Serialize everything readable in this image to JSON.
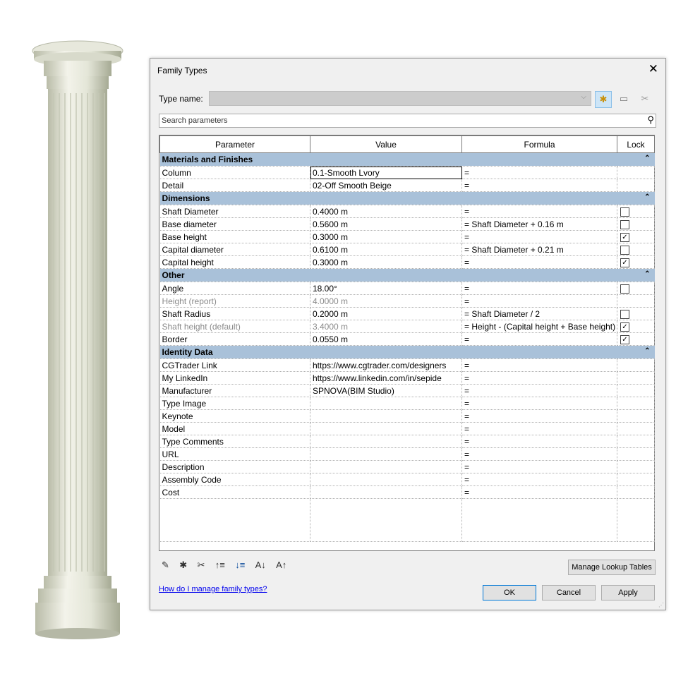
{
  "dialog": {
    "title": "Family Types",
    "type_name_label": "Type name:",
    "type_name_value": "",
    "search_placeholder": "Search parameters",
    "help_link": "How do I manage family types?",
    "buttons": {
      "manage_lookup": "Manage Lookup Tables",
      "ok": "OK",
      "cancel": "Cancel",
      "apply": "Apply"
    }
  },
  "table": {
    "headers": [
      "Parameter",
      "Value",
      "Formula",
      "Lock"
    ],
    "groups": [
      {
        "name": "Materials and Finishes",
        "rows": [
          {
            "param": "Column",
            "value": "0.1-Smooth Lvory",
            "formula": "=",
            "lock": null,
            "selected": true
          },
          {
            "param": "Detail",
            "value": "02-Off Smooth Beige",
            "formula": "=",
            "lock": null
          }
        ]
      },
      {
        "name": "Dimensions",
        "rows": [
          {
            "param": "Shaft Diameter",
            "value": "0.4000 m",
            "formula": "=",
            "lock": false
          },
          {
            "param": "Base diameter",
            "value": "0.5600 m",
            "formula": "= Shaft Diameter + 0.16 m",
            "lock": false
          },
          {
            "param": "Base height",
            "value": "0.3000 m",
            "formula": "=",
            "lock": true
          },
          {
            "param": "Capital diameter",
            "value": "0.6100 m",
            "formula": "= Shaft Diameter + 0.21 m",
            "lock": false
          },
          {
            "param": "Capital height",
            "value": "0.3000 m",
            "formula": "=",
            "lock": true
          }
        ]
      },
      {
        "name": "Other",
        "rows": [
          {
            "param": "Angle",
            "value": "18.00°",
            "formula": "=",
            "lock": false
          },
          {
            "param": "Height (report)",
            "value": "4.0000 m",
            "formula": "=",
            "lock": null,
            "grey": true
          },
          {
            "param": "Shaft Radius",
            "value": "0.2000 m",
            "formula": "= Shaft Diameter / 2",
            "lock": false
          },
          {
            "param": "Shaft height (default)",
            "value": "3.4000 m",
            "formula": "= Height - (Capital height + Base height)",
            "lock": true,
            "grey": true
          },
          {
            "param": "Border",
            "value": "0.0550 m",
            "formula": "=",
            "lock": true
          }
        ]
      },
      {
        "name": "Identity Data",
        "rows": [
          {
            "param": "CGTrader Link",
            "value": "https://www.cgtrader.com/designers",
            "formula": "=",
            "lock": null
          },
          {
            "param": "My LinkedIn",
            "value": "https://www.linkedin.com/in/sepide",
            "formula": "=",
            "lock": null
          },
          {
            "param": "Manufacturer",
            "value": "SPNOVA(BIM Studio)",
            "formula": "=",
            "lock": null
          },
          {
            "param": "Type Image",
            "value": "",
            "formula": "=",
            "lock": null
          },
          {
            "param": "Keynote",
            "value": "",
            "formula": "=",
            "lock": null
          },
          {
            "param": "Model",
            "value": "",
            "formula": "=",
            "lock": null
          },
          {
            "param": "Type Comments",
            "value": "",
            "formula": "=",
            "lock": null
          },
          {
            "param": "URL",
            "value": "",
            "formula": "=",
            "lock": null
          },
          {
            "param": "Description",
            "value": "",
            "formula": "=",
            "lock": null
          },
          {
            "param": "Assembly Code",
            "value": "",
            "formula": "=",
            "lock": null
          },
          {
            "param": "Cost",
            "value": "",
            "formula": "=",
            "lock": null
          }
        ]
      }
    ]
  },
  "icons": {
    "toolbar": [
      "new-type-icon",
      "rename-type-icon",
      "delete-type-icon"
    ],
    "bottom": [
      "edit-parameter-icon",
      "new-parameter-icon",
      "delete-parameter-icon",
      "move-up-icon",
      "move-down-icon",
      "sort-ascending-icon",
      "sort-descending-icon"
    ]
  },
  "colors": {
    "group_header": "#a9c1d9",
    "accent": "#0078d7",
    "link": "#0000ee"
  }
}
